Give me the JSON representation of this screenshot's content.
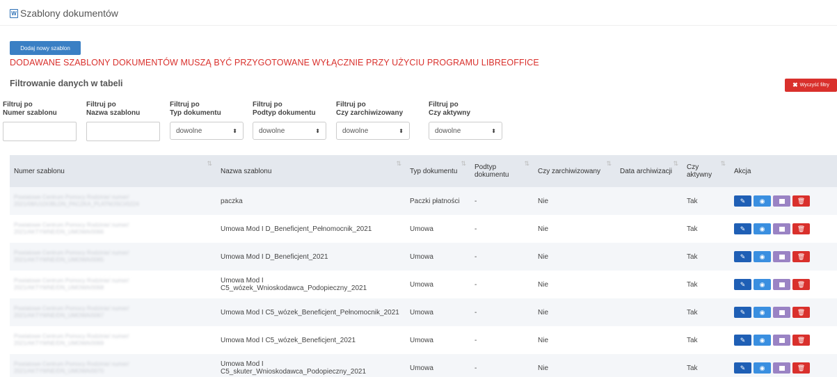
{
  "header": {
    "title": "Szablony dokumentów",
    "icon": "word-document-icon"
  },
  "add_button": "Dodaj nowy szablon",
  "warning": "DODAWANE SZABLONY DOKUMENTÓW MUSZĄ BYĆ PRZYGOTOWANE WYŁĄCZNIE PRZY UŻYCIU PROGRAMU LIBREOFFICE",
  "filter_title": "Filtrowanie danych w tabeli",
  "clear_button": "Wyczyść filtry",
  "filters": [
    {
      "line1": "Filtruj po",
      "line2": "Numer szablonu",
      "type": "text",
      "value": ""
    },
    {
      "line1": "Filtruj po",
      "line2": "Nazwa szablonu",
      "type": "text",
      "value": ""
    },
    {
      "line1": "Filtruj po",
      "line2": "Typ dokumentu",
      "type": "select",
      "value": "dowolne"
    },
    {
      "line1": "Filtruj po",
      "line2": "Podtyp dokumentu",
      "type": "select",
      "value": "dowolne"
    },
    {
      "line1": "Filtruj po",
      "line2": "Czy zarchiwizowany",
      "type": "select",
      "value": "dowolne"
    },
    {
      "line1": "Filtruj po",
      "line2": "Czy aktywny",
      "type": "select",
      "value": "dowolne"
    }
  ],
  "table": {
    "columns": [
      "Numer szablonu",
      "Nazwa szablonu",
      "Typ dokumentu",
      "Podtyp dokumentu",
      "Czy zarchiwizowany",
      "Data archiwizacji",
      "Czy aktywny",
      "Akcja"
    ],
    "rows": [
      {
        "number": "Powiatowe Centrum Pomocy Rodzinie/ numer/ 2021/08/U1DOBLDN_PACZKA_PLATNOSCI/0224",
        "name": "paczka",
        "type": "Paczki płatności",
        "subtype": "-",
        "archived": "Nie",
        "archive_date": "",
        "active": "Tak"
      },
      {
        "number": "Powiatowe Centrum Pomocy Rodzinie/ numer/ 2021/AKTYWNE/DN_UMOWA/0066",
        "name": "Umowa Mod I D_Beneficjent_Pełnomocnik_2021",
        "type": "Umowa",
        "subtype": "-",
        "archived": "Nie",
        "archive_date": "",
        "active": "Tak"
      },
      {
        "number": "Powiatowe Centrum Pomocy Rodzinie/ numer/ 2021/AKTYWNE/DN_UMOWA/0065",
        "name": "Umowa Mod I D_Beneficjent_2021",
        "type": "Umowa",
        "subtype": "-",
        "archived": "Nie",
        "archive_date": "",
        "active": "Tak"
      },
      {
        "number": "Powiatowe Centrum Pomocy Rodzinie/ numer/ 2021/AKTYWNE/DN_UMOWA/0068",
        "name": "Umowa Mod I C5_wózek_Wnioskodawca_Podopieczny_2021",
        "type": "Umowa",
        "subtype": "-",
        "archived": "Nie",
        "archive_date": "",
        "active": "Tak"
      },
      {
        "number": "Powiatowe Centrum Pomocy Rodzinie/ numer/ 2021/AKTYWNE/DN_UMOWA/0067",
        "name": "Umowa Mod I C5_wózek_Beneficjent_Pełnomocnik_2021",
        "type": "Umowa",
        "subtype": "-",
        "archived": "Nie",
        "archive_date": "",
        "active": "Tak"
      },
      {
        "number": "Powiatowe Centrum Pomocy Rodzinie/ numer/ 2021/AKTYWNE/DN_UMOWA/0069",
        "name": "Umowa Mod I C5_wózek_Beneficjent_2021",
        "type": "Umowa",
        "subtype": "-",
        "archived": "Nie",
        "archive_date": "",
        "active": "Tak"
      },
      {
        "number": "Powiatowe Centrum Pomocy Rodzinie/ numer/ 2021/AKTYWNE/DN_UMOWA/0070",
        "name": "Umowa Mod I C5_skuter_Wnioskodawca_Podopieczny_2021",
        "type": "Umowa",
        "subtype": "-",
        "archived": "Nie",
        "archive_date": "",
        "active": "Tak"
      }
    ]
  },
  "icons": {
    "edit": "pencil-icon",
    "view": "eye-icon",
    "archive": "archive-icon",
    "delete": "trash-icon",
    "sort": "sort-icon",
    "clear": "x-icon",
    "chevron": "chevron-updown-icon"
  },
  "colors": {
    "primary": "#3a7fc4",
    "danger": "#d9302c",
    "edit": "#1f5fb5",
    "view": "#3a8fe0",
    "archive": "#9a83c4",
    "header_bg": "#e4e8ee"
  }
}
